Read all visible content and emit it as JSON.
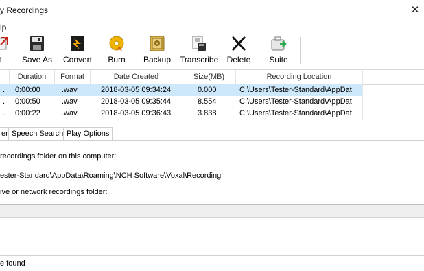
{
  "window": {
    "title": "y Recordings"
  },
  "menu": {
    "items": [
      "lp"
    ]
  },
  "toolbar": {
    "buttons": [
      {
        "label": "t",
        "icon": "open-icon"
      },
      {
        "label": "Save As",
        "icon": "floppy-disk-icon"
      },
      {
        "label": "Convert",
        "icon": "convert-icon"
      },
      {
        "label": "Burn",
        "icon": "disc-icon"
      },
      {
        "label": "Backup",
        "icon": "safe-icon"
      },
      {
        "label": "Transcribe",
        "icon": "transcribe-icon"
      },
      {
        "label": "Delete",
        "icon": "x-delete-icon"
      },
      {
        "label": "Suite",
        "icon": "suite-icon"
      }
    ]
  },
  "table": {
    "columns": [
      "Duration",
      "Format",
      "Date Created",
      "Size(MB)",
      "Recording Location"
    ],
    "rows": [
      {
        "duration": "0:00:00",
        "format": ".wav",
        "date": "2018-03-05 09:34:24",
        "size": "0.000",
        "location": "C:\\Users\\Tester-Standard\\AppDat",
        "selected": true
      },
      {
        "duration": "0:00:50",
        "format": ".wav",
        "date": "2018-03-05 09:35:44",
        "size": "8.554",
        "location": "C:\\Users\\Tester-Standard\\AppDat",
        "selected": false
      },
      {
        "duration": "0:00:22",
        "format": ".wav",
        "date": "2018-03-05 09:36:43",
        "size": "3.838",
        "location": "C:\\Users\\Tester-Standard\\AppDat",
        "selected": false
      }
    ]
  },
  "tabs": [
    "er",
    "Speech Search",
    "Play Options"
  ],
  "panel": {
    "folder_label": "recordings folder on this computer:",
    "folder_path": "ester-Standard\\AppData\\Roaming\\NCH Software\\Voxal\\Recording",
    "network_label": "ive or network recordings folder:",
    "network_value": ""
  },
  "status": {
    "text": "e found"
  },
  "colors": {
    "selection": "#cde8fb",
    "accent_red": "#c8201a",
    "accent_green": "#2fa84f"
  }
}
